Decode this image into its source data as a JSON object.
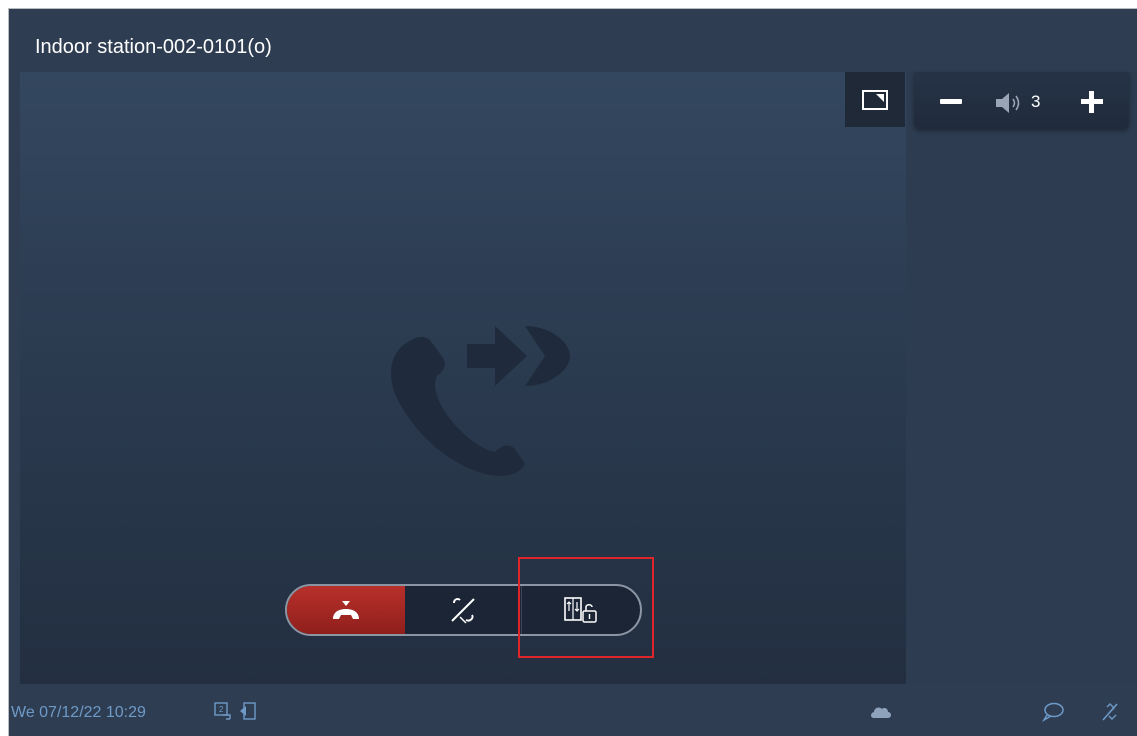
{
  "header": {
    "title": "Indoor station-002-0101(o)"
  },
  "volume": {
    "level": "3",
    "minus_icon": "minus-icon",
    "speaker_icon": "speaker-icon",
    "plus_icon": "plus-icon"
  },
  "video": {
    "expand_icon": "expand-view-icon",
    "watermark_icon": "call-forward-icon"
  },
  "call_controls": {
    "hangup_icon": "hang-up-icon",
    "mute_icon": "mute-microphone-icon",
    "unlock_icon": "elevator-unlock-icon"
  },
  "status_bar": {
    "datetime": "We 07/12/22  10:29",
    "icons": [
      "message-icon",
      "door-icon",
      "cloud-icon",
      "chat-icon",
      "mic-off-icon"
    ]
  },
  "colors": {
    "background": "#2e3d52",
    "hangup": "#a82824",
    "highlight": "#e0252a",
    "status_text": "#6e9ac8"
  }
}
